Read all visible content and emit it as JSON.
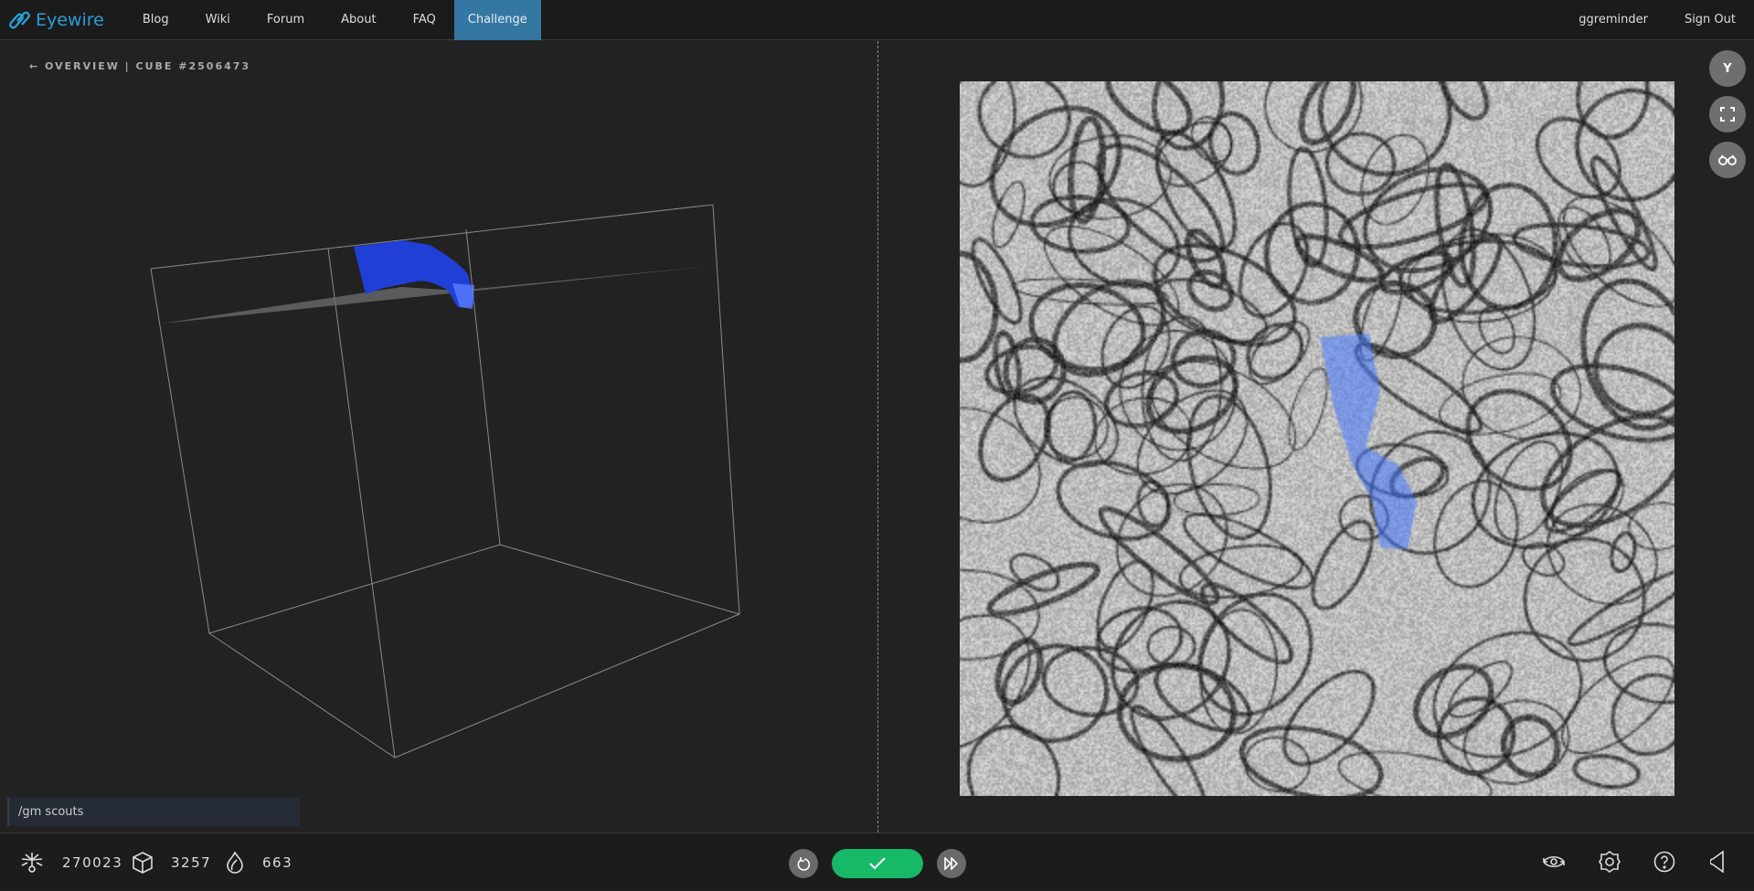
{
  "nav": {
    "brand": "Eyewire",
    "items": [
      "Blog",
      "Wiki",
      "Forum",
      "About",
      "FAQ",
      "Challenge"
    ],
    "active": "Challenge",
    "user": "ggreminder",
    "signout": "Sign Out"
  },
  "breadcrumb": "← OVERVIEW | CUBE #2506473",
  "side_buttons": {
    "axis_label": "Y"
  },
  "chat": {
    "value": "/gm scouts"
  },
  "stats": {
    "neurons": "270023",
    "cubes": "3257",
    "points": "663"
  },
  "colors": {
    "accent": "#2a9fd6",
    "active_tab": "#3477a3",
    "submit": "#17b866",
    "segment": "#1f3fd6",
    "em_overlay": "#5a8cff"
  }
}
